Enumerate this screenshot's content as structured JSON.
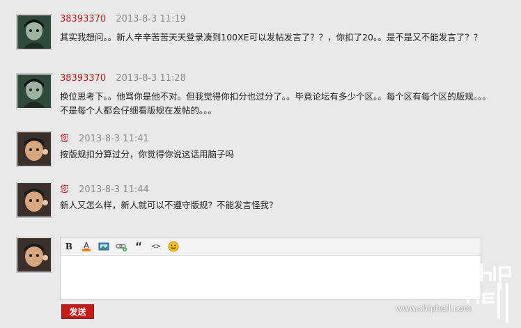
{
  "messages": [
    {
      "author": "38393370",
      "time": "2013-8-3 11:19",
      "avatar": "dark-avatar",
      "text": "其实我想问。。新人辛辛苦苦天天登录凑到100XE可以发帖发言了？？，你扣了20。。是不是又不能发言了？？"
    },
    {
      "author": "38393370",
      "time": "2013-8-3 11:28",
      "avatar": "dark-avatar",
      "text": "换位思考下。。他骂你是他不对。但我觉得你扣分也过分了。。毕竟论坛有多少个区。。每个区有每个区的版规。。。不是每个人都会仔细看版规在发帖的。。。"
    },
    {
      "author": "您",
      "time": "2013-8-3 11:41",
      "avatar": "kid-avatar",
      "text": "按版规扣分算过分，你觉得你说这话用脑子吗"
    },
    {
      "author": "您",
      "time": "2013-8-3 11:44",
      "avatar": "kid-avatar",
      "text": "新人又怎么样，新人就可以不遵守版规？不能发言怪我？"
    }
  ],
  "editor": {
    "toolbar": [
      "bold-icon",
      "font-color-icon",
      "image-icon",
      "link-icon",
      "quote-icon",
      "code-icon",
      "smiley-icon"
    ],
    "bold_label": "B",
    "color_label": "A",
    "quote_label": "“",
    "code_label": "<>",
    "placeholder": ""
  },
  "send_label": "发送",
  "watermark": "www.chiphell.com",
  "colors": {
    "author": "#b41d1d",
    "send": "#c31a1a"
  }
}
